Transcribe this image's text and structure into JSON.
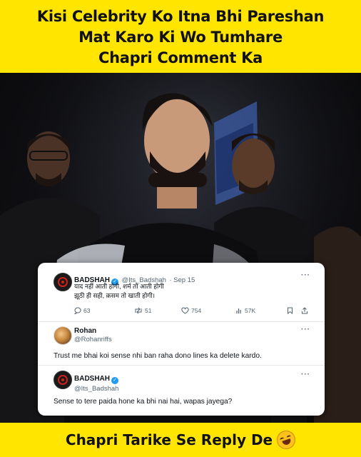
{
  "top_caption": {
    "line1": "Kisi Celebrity Ko Itna Bhi Pareshan",
    "line2": "Mat Karo Ki Wo Tumhare",
    "line3": "Chapri Comment Ka"
  },
  "bottom_caption": "Chapri Tarike Se Reply De",
  "tweet": {
    "name": "BADSHAH",
    "handle": "@Its_Badshah",
    "date": "· Sep 15",
    "line1": "याद नहीं आती होगी, शर्म तो आती होगी",
    "line2": "झूठी ही सही, क़सम तो खाती होगी।",
    "replies": "63",
    "retweets": "51",
    "likes": "754",
    "views": "57K"
  },
  "reply1": {
    "name": "Rohan",
    "handle": "@Rohanriffs",
    "text": "Trust me bhai koi sense nhi ban raha dono lines ka delete kardo."
  },
  "reply2": {
    "name": "BADSHAH",
    "handle": "@Its_Badshah",
    "text": "Sense to tere paida hone ka bhi nai hai, wapas jayega?"
  },
  "colors": {
    "banner": "#ffe500",
    "verified": "#1d9bf0"
  }
}
